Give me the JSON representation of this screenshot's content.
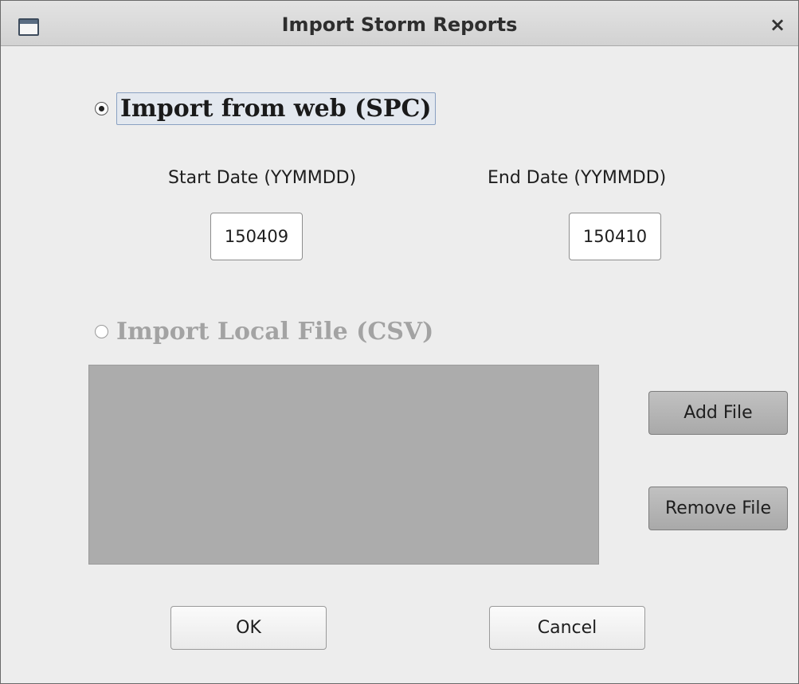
{
  "window": {
    "title": "Import Storm Reports",
    "close_symbol": "×",
    "icon": "window-icon"
  },
  "web_import": {
    "label": "Import from web (SPC)",
    "selected": true,
    "start_date_label": "Start Date (YYMMDD)",
    "start_date_value": "150409",
    "end_date_label": "End Date (YYMMDD)",
    "end_date_value": "150410"
  },
  "local_import": {
    "label": "Import Local File (CSV)",
    "selected": false,
    "enabled": false,
    "files": [],
    "add_file_label": "Add File",
    "remove_file_label": "Remove File"
  },
  "footer": {
    "ok_label": "OK",
    "cancel_label": "Cancel"
  },
  "colors": {
    "window_bg": "#ededed",
    "list_bg": "#acacac",
    "disabled_text": "#a3a3a3"
  }
}
